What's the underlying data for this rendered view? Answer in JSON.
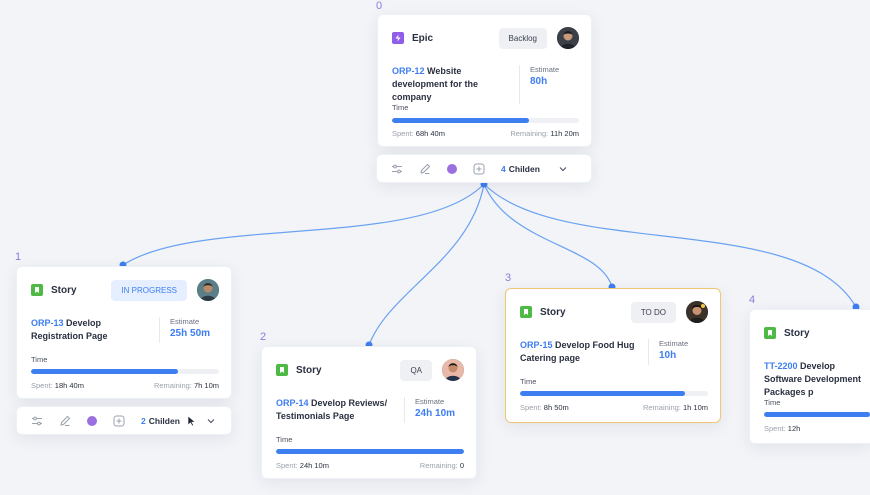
{
  "indices": [
    "0",
    "1",
    "2",
    "3",
    "4"
  ],
  "epic": {
    "type": "Epic",
    "status": "Backlog",
    "key": "ORP-12",
    "title": "Website development for the company",
    "estimate_label": "Estimate",
    "estimate": "80h",
    "time_label": "Time",
    "progress": 0.73,
    "spent_label": "Spent:",
    "spent": "68h 40m",
    "remaining_label": "Remaining:",
    "remaining": "11h 20m"
  },
  "epic_toolbar": {
    "children_count": "4",
    "children_label": "Childen"
  },
  "card1": {
    "type": "Story",
    "status": "IN PROGRESS",
    "key": "ORP-13",
    "title": "Develop Registration Page",
    "estimate_label": "Estimate",
    "estimate": "25h 50m",
    "time_label": "Time",
    "progress": 0.78,
    "spent_label": "Spent:",
    "spent": "18h 40m",
    "remaining_label": "Remaining:",
    "remaining": "7h 10m"
  },
  "card1_toolbar": {
    "children_count": "2",
    "children_label": "Childen"
  },
  "card2": {
    "type": "Story",
    "status": "QA",
    "key": "ORP-14",
    "title": "Develop Reviews/ Testimonials Page",
    "estimate_label": "Estimate",
    "estimate": "24h 10m",
    "time_label": "Time",
    "progress": 1.0,
    "spent_label": "Spent:",
    "spent": "24h 10m",
    "remaining_label": "Remaining:",
    "remaining": "0"
  },
  "card3": {
    "type": "Story",
    "status": "TO DO",
    "key": "ORP-15",
    "title": "Develop Food Hug Catering page",
    "estimate_label": "Estimate",
    "estimate": "10h",
    "time_label": "Time",
    "progress": 0.88,
    "spent_label": "Spent:",
    "spent": "8h 50m",
    "remaining_label": "Remaining:",
    "remaining": "1h 10m"
  },
  "card4": {
    "type": "Story",
    "key": "TT-2200",
    "title": "Develop Software Development Packages p",
    "time_label": "Time",
    "progress": 1.0,
    "spent_label": "Spent:",
    "spent": "12h"
  },
  "colors": {
    "accent": "#3d7ef0",
    "epic": "#8f5ee8",
    "story": "#4fb945",
    "highlight_border": "#f0c674"
  }
}
